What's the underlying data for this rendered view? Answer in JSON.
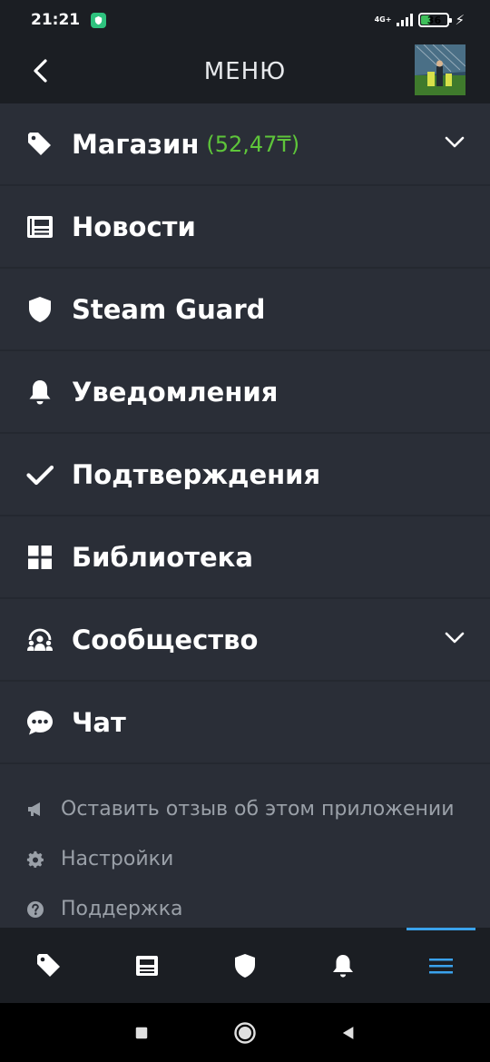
{
  "status_bar": {
    "time": "21:21",
    "network": "4G+",
    "battery": "36",
    "battery_level": 0.36
  },
  "header": {
    "title": "МЕНЮ"
  },
  "menu": {
    "items": [
      {
        "label": "Магазин",
        "balance": "(52,47₸)",
        "icon": "tag-icon",
        "expandable": true
      },
      {
        "label": "Новости",
        "icon": "news-icon"
      },
      {
        "label": "Steam Guard",
        "icon": "shield-icon"
      },
      {
        "label": "Уведомления",
        "icon": "bell-icon"
      },
      {
        "label": "Подтверждения",
        "icon": "checkmark-icon"
      },
      {
        "label": "Библиотека",
        "icon": "grid-icon"
      },
      {
        "label": "Сообщество",
        "icon": "community-icon",
        "expandable": true
      },
      {
        "label": "Чат",
        "icon": "chat-icon"
      }
    ],
    "secondary": [
      {
        "label": "Оставить отзыв об этом приложении",
        "icon": "megaphone-icon"
      },
      {
        "label": "Настройки",
        "icon": "gear-icon"
      },
      {
        "label": "Поддержка",
        "icon": "help-icon"
      }
    ]
  },
  "tabbar": {
    "tabs": [
      {
        "icon": "tag-icon",
        "active": false
      },
      {
        "icon": "news-icon",
        "active": false
      },
      {
        "icon": "shield-icon",
        "active": false
      },
      {
        "icon": "bell-icon",
        "active": false
      },
      {
        "icon": "menu-icon",
        "active": true
      }
    ]
  },
  "colors": {
    "accent": "#3aa2ec",
    "balance": "#5ec53a",
    "menu_bg": "#2a2e37",
    "header_bg": "#1b1e23"
  }
}
